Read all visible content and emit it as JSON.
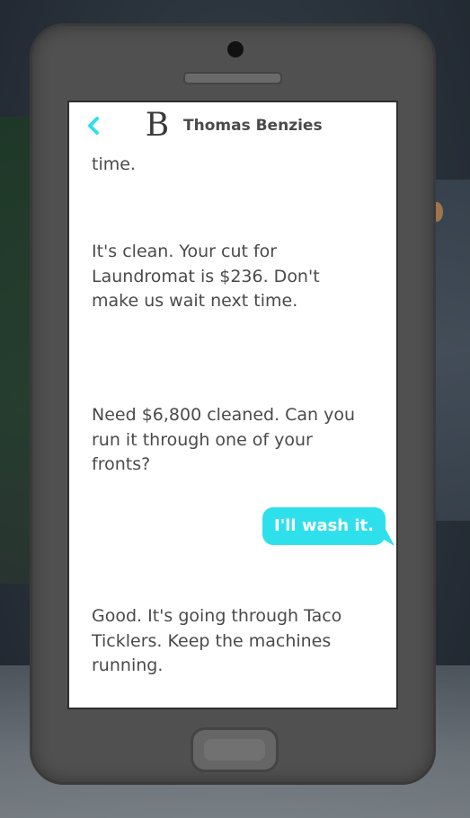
{
  "header": {
    "back_icon": "chevron-left-icon",
    "avatar_letter": "B",
    "contact_name": "Thomas Benzies",
    "accent_color": "#2ee0ec"
  },
  "messages": [
    {
      "direction": "incoming",
      "text": "time."
    },
    {
      "direction": "incoming",
      "text": "It's clean. Your cut for Laundromat is $236. Don't make us wait next time."
    },
    {
      "direction": "incoming",
      "text": "Need $6,800 cleaned. Can you run it through one of your fronts?"
    },
    {
      "direction": "outgoing",
      "text": "I'll wash it."
    },
    {
      "direction": "incoming",
      "text": "Good. It's going through Taco Ticklers. Keep the machines running."
    }
  ]
}
